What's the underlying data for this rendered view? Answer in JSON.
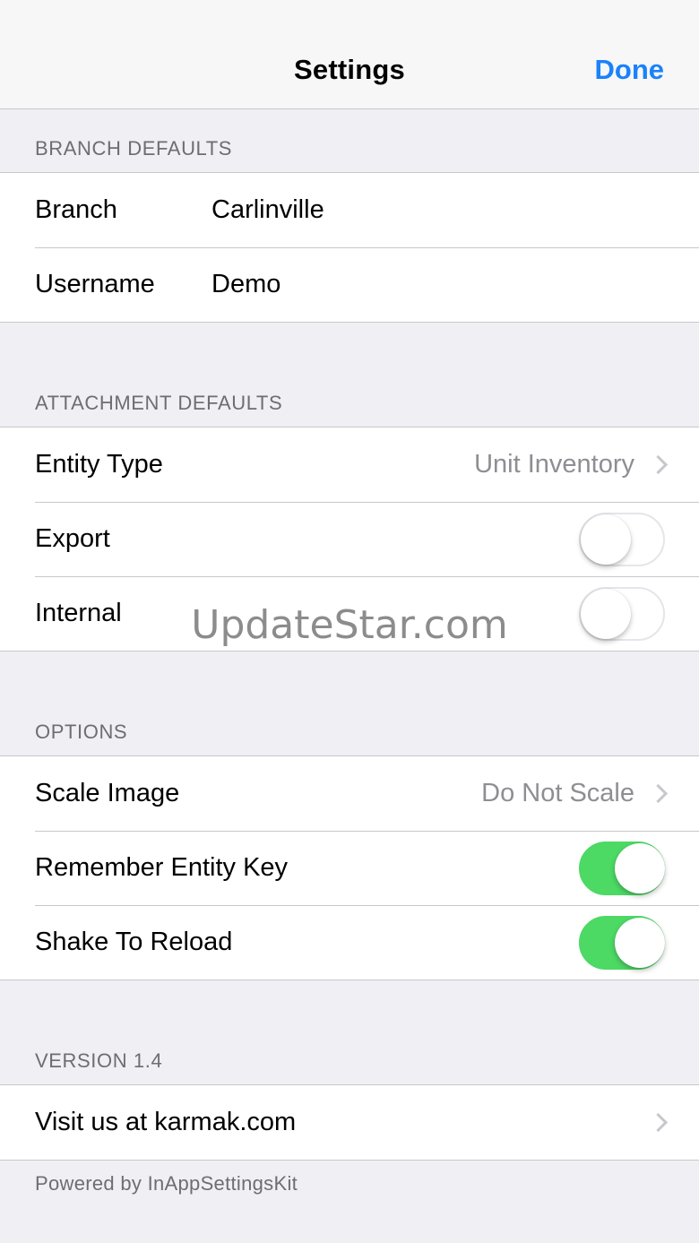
{
  "navbar": {
    "title": "Settings",
    "done_label": "Done"
  },
  "branch_defaults": {
    "header": "BRANCH DEFAULTS",
    "branch_label": "Branch",
    "branch_value": "Carlinville",
    "username_label": "Username",
    "username_value": "Demo"
  },
  "attachment_defaults": {
    "header": "ATTACHMENT DEFAULTS",
    "entity_type_label": "Entity Type",
    "entity_type_value": "Unit Inventory",
    "export_label": "Export",
    "export_on": false,
    "internal_label": "Internal",
    "internal_on": false
  },
  "options": {
    "header": "OPTIONS",
    "scale_image_label": "Scale Image",
    "scale_image_value": "Do Not Scale",
    "remember_entity_key_label": "Remember Entity Key",
    "remember_entity_key_on": true,
    "shake_to_reload_label": "Shake To Reload",
    "shake_to_reload_on": true
  },
  "version": {
    "header": "VERSION 1.4",
    "visit_label": "Visit us at karmak.com",
    "footer": "Powered by InAppSettingsKit"
  },
  "watermark": "UpdateStar.com",
  "colors": {
    "accent": "#1a82fb",
    "toggle_on": "#4cd964",
    "background": "#efeff4",
    "secondary_text": "#8e8e93"
  },
  "icons": {
    "disclosure": "chevron-right-icon"
  }
}
